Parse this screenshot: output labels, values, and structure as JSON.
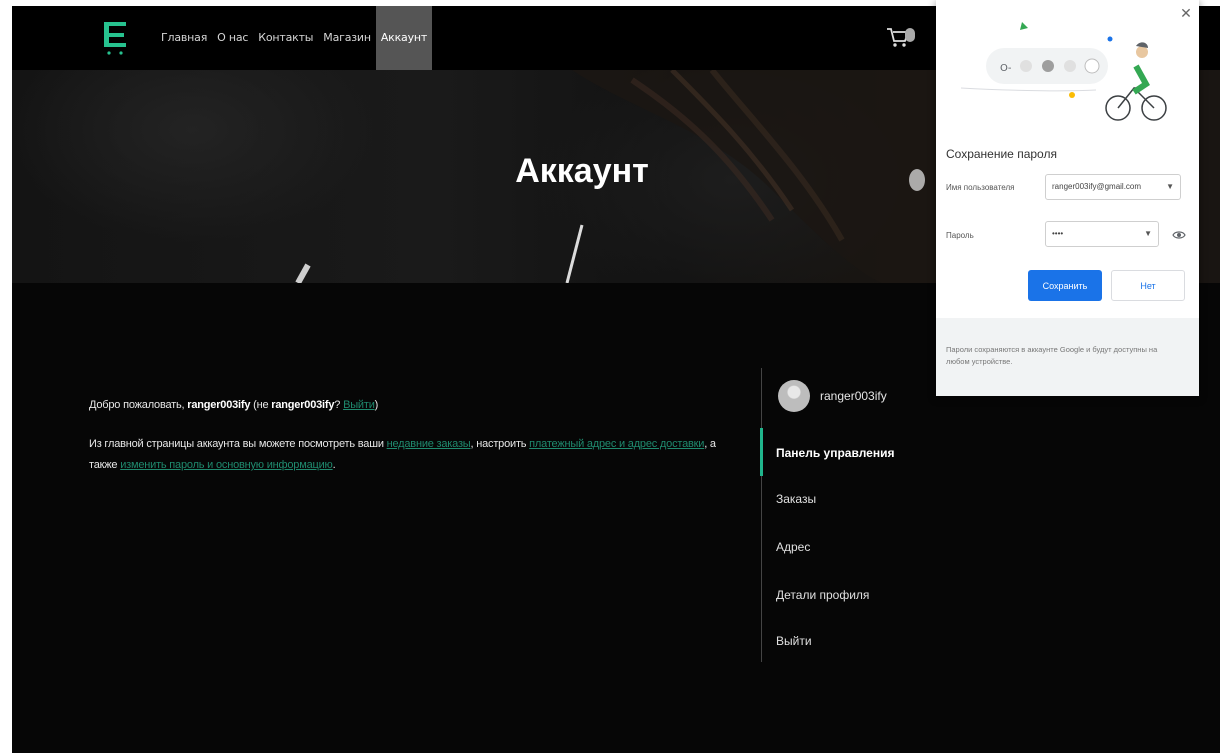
{
  "nav": {
    "items": [
      "Главная",
      "О нас",
      "Контакты",
      "Магазин",
      "Аккаунт"
    ],
    "active_index": 4
  },
  "icons": {
    "logo": "store-logo-icon",
    "cart": "cart-icon",
    "close": "close-icon",
    "eye": "eye-icon",
    "dropdown": "chevron-down-icon"
  },
  "hero": {
    "title": "Аккаунт"
  },
  "account": {
    "welcome": {
      "prefix": "Добро пожаловать, ",
      "username": "ranger003ify",
      "not_prefix": " (не ",
      "not_username": "ranger003ify",
      "question": "? ",
      "logout_link": "Выйти",
      "close": ")"
    },
    "intro": {
      "part1": "Из главной страницы аккаунта вы можете посмотреть ваши ",
      "link1": "недавние заказы",
      "part2": ", настроить ",
      "link2": "платежный адрес и адрес доставки",
      "part3": ", а также ",
      "link3": "изменить пароль и основную информацию",
      "part4": "."
    },
    "sidebar": {
      "username": "ranger003ify",
      "items": [
        "Панель управления",
        "Заказы",
        "Адрес",
        "Детали профиля",
        "Выйти"
      ],
      "active_index": 0
    }
  },
  "password_popup": {
    "title": "Сохранение пароля",
    "username_label": "Имя пользователя",
    "username_value": "ranger003ify@gmail.com",
    "password_label": "Пароль",
    "password_value": "••••",
    "save_button": "Сохранить",
    "no_button": "Нет",
    "footer": "Пароли сохраняются в аккаунте Google и будут доступны на любом устройстве."
  },
  "colors": {
    "accent": "#20b58c",
    "link": "#1f8a6e",
    "primary_button": "#1a73e8",
    "background": "#060606"
  }
}
